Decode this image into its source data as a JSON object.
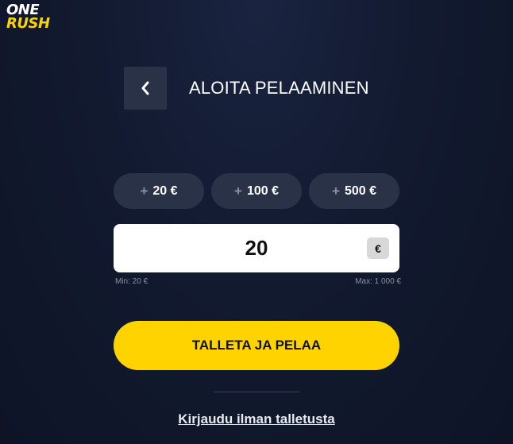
{
  "logo": {
    "line1": "ONE",
    "line2": "RUSH"
  },
  "header": {
    "title": "ALOITA PELAAMINEN",
    "back_icon": "chevron-left-icon"
  },
  "quick_amounts": [
    {
      "plus": "+",
      "label": "20 €"
    },
    {
      "plus": "+",
      "label": "100 €"
    },
    {
      "plus": "+",
      "label": "500 €"
    }
  ],
  "amount_input": {
    "value": "20",
    "currency": "€"
  },
  "limits": {
    "min": "Min: 20 €",
    "max": "Max: 1 000 €"
  },
  "cta": {
    "label": "TALLETA JA PELAA"
  },
  "login_link": {
    "label": "Kirjaudu ilman talletusta"
  },
  "colors": {
    "accent": "#ffd300",
    "background": "#121a30",
    "button_bg": "#2a3247"
  }
}
